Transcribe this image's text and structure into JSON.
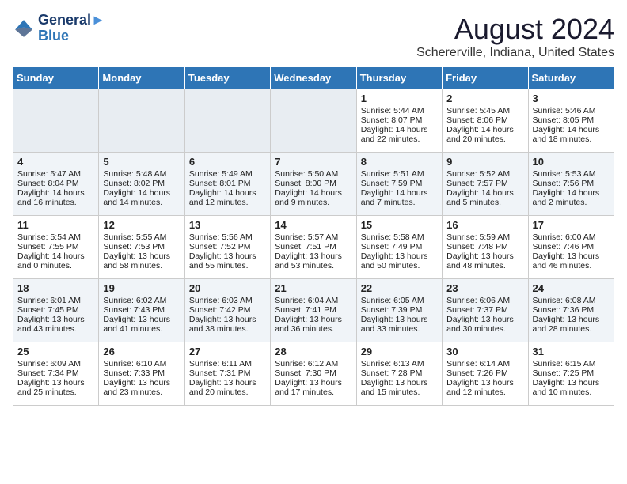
{
  "logo": {
    "line1": "General",
    "line2": "Blue"
  },
  "title": "August 2024",
  "subtitle": "Schererville, Indiana, United States",
  "days_of_week": [
    "Sunday",
    "Monday",
    "Tuesday",
    "Wednesday",
    "Thursday",
    "Friday",
    "Saturday"
  ],
  "weeks": [
    [
      {
        "day": "",
        "content": ""
      },
      {
        "day": "",
        "content": ""
      },
      {
        "day": "",
        "content": ""
      },
      {
        "day": "",
        "content": ""
      },
      {
        "day": "1",
        "content": "Sunrise: 5:44 AM\nSunset: 8:07 PM\nDaylight: 14 hours\nand 22 minutes."
      },
      {
        "day": "2",
        "content": "Sunrise: 5:45 AM\nSunset: 8:06 PM\nDaylight: 14 hours\nand 20 minutes."
      },
      {
        "day": "3",
        "content": "Sunrise: 5:46 AM\nSunset: 8:05 PM\nDaylight: 14 hours\nand 18 minutes."
      }
    ],
    [
      {
        "day": "4",
        "content": "Sunrise: 5:47 AM\nSunset: 8:04 PM\nDaylight: 14 hours\nand 16 minutes."
      },
      {
        "day": "5",
        "content": "Sunrise: 5:48 AM\nSunset: 8:02 PM\nDaylight: 14 hours\nand 14 minutes."
      },
      {
        "day": "6",
        "content": "Sunrise: 5:49 AM\nSunset: 8:01 PM\nDaylight: 14 hours\nand 12 minutes."
      },
      {
        "day": "7",
        "content": "Sunrise: 5:50 AM\nSunset: 8:00 PM\nDaylight: 14 hours\nand 9 minutes."
      },
      {
        "day": "8",
        "content": "Sunrise: 5:51 AM\nSunset: 7:59 PM\nDaylight: 14 hours\nand 7 minutes."
      },
      {
        "day": "9",
        "content": "Sunrise: 5:52 AM\nSunset: 7:57 PM\nDaylight: 14 hours\nand 5 minutes."
      },
      {
        "day": "10",
        "content": "Sunrise: 5:53 AM\nSunset: 7:56 PM\nDaylight: 14 hours\nand 2 minutes."
      }
    ],
    [
      {
        "day": "11",
        "content": "Sunrise: 5:54 AM\nSunset: 7:55 PM\nDaylight: 14 hours\nand 0 minutes."
      },
      {
        "day": "12",
        "content": "Sunrise: 5:55 AM\nSunset: 7:53 PM\nDaylight: 13 hours\nand 58 minutes."
      },
      {
        "day": "13",
        "content": "Sunrise: 5:56 AM\nSunset: 7:52 PM\nDaylight: 13 hours\nand 55 minutes."
      },
      {
        "day": "14",
        "content": "Sunrise: 5:57 AM\nSunset: 7:51 PM\nDaylight: 13 hours\nand 53 minutes."
      },
      {
        "day": "15",
        "content": "Sunrise: 5:58 AM\nSunset: 7:49 PM\nDaylight: 13 hours\nand 50 minutes."
      },
      {
        "day": "16",
        "content": "Sunrise: 5:59 AM\nSunset: 7:48 PM\nDaylight: 13 hours\nand 48 minutes."
      },
      {
        "day": "17",
        "content": "Sunrise: 6:00 AM\nSunset: 7:46 PM\nDaylight: 13 hours\nand 46 minutes."
      }
    ],
    [
      {
        "day": "18",
        "content": "Sunrise: 6:01 AM\nSunset: 7:45 PM\nDaylight: 13 hours\nand 43 minutes."
      },
      {
        "day": "19",
        "content": "Sunrise: 6:02 AM\nSunset: 7:43 PM\nDaylight: 13 hours\nand 41 minutes."
      },
      {
        "day": "20",
        "content": "Sunrise: 6:03 AM\nSunset: 7:42 PM\nDaylight: 13 hours\nand 38 minutes."
      },
      {
        "day": "21",
        "content": "Sunrise: 6:04 AM\nSunset: 7:41 PM\nDaylight: 13 hours\nand 36 minutes."
      },
      {
        "day": "22",
        "content": "Sunrise: 6:05 AM\nSunset: 7:39 PM\nDaylight: 13 hours\nand 33 minutes."
      },
      {
        "day": "23",
        "content": "Sunrise: 6:06 AM\nSunset: 7:37 PM\nDaylight: 13 hours\nand 30 minutes."
      },
      {
        "day": "24",
        "content": "Sunrise: 6:08 AM\nSunset: 7:36 PM\nDaylight: 13 hours\nand 28 minutes."
      }
    ],
    [
      {
        "day": "25",
        "content": "Sunrise: 6:09 AM\nSunset: 7:34 PM\nDaylight: 13 hours\nand 25 minutes."
      },
      {
        "day": "26",
        "content": "Sunrise: 6:10 AM\nSunset: 7:33 PM\nDaylight: 13 hours\nand 23 minutes."
      },
      {
        "day": "27",
        "content": "Sunrise: 6:11 AM\nSunset: 7:31 PM\nDaylight: 13 hours\nand 20 minutes."
      },
      {
        "day": "28",
        "content": "Sunrise: 6:12 AM\nSunset: 7:30 PM\nDaylight: 13 hours\nand 17 minutes."
      },
      {
        "day": "29",
        "content": "Sunrise: 6:13 AM\nSunset: 7:28 PM\nDaylight: 13 hours\nand 15 minutes."
      },
      {
        "day": "30",
        "content": "Sunrise: 6:14 AM\nSunset: 7:26 PM\nDaylight: 13 hours\nand 12 minutes."
      },
      {
        "day": "31",
        "content": "Sunrise: 6:15 AM\nSunset: 7:25 PM\nDaylight: 13 hours\nand 10 minutes."
      }
    ]
  ]
}
